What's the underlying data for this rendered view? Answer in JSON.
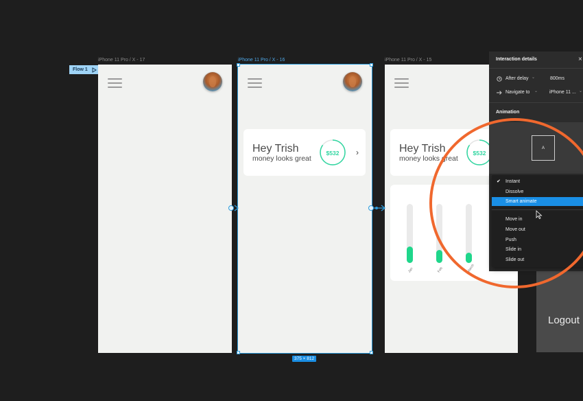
{
  "canvas": {
    "flow_tag": {
      "label": "Flow 1",
      "icon": "play-outline-icon"
    },
    "frames": [
      {
        "label": "iPhone 11 Pro / X - 17"
      },
      {
        "label": "iPhone 11 Pro / X - 16",
        "selected": true,
        "size_label": "375 × 812"
      },
      {
        "label": "iPhone 11 Pro / X - 15"
      }
    ],
    "app": {
      "greeting": "Hey Trish",
      "subtitle": "money looks great",
      "amount": "$532",
      "amount_progress": 0.85,
      "chevron": "›",
      "accent": "#2fd6a0",
      "bar_color": "#1fd68b",
      "bars": [
        {
          "label": "Jan",
          "value": 0.28
        },
        {
          "label": "Feb",
          "value": 0.22
        },
        {
          "label": "March",
          "value": 0.18
        }
      ]
    },
    "logout_label": "Logout",
    "highlight_color": "#f0682e"
  },
  "panel": {
    "title": "Interaction details",
    "close_icon": "×",
    "trigger": {
      "icon": "timer-icon",
      "label": "After delay",
      "value": "800ms"
    },
    "action": {
      "icon": "arrow-right-icon",
      "label": "Navigate to",
      "value": "iPhone 11 ..."
    },
    "animation_title": "Animation",
    "preview_letter": "A",
    "caret": "⌄",
    "menu": {
      "items": [
        {
          "label": "Instant",
          "checked": true
        },
        {
          "label": "Dissolve"
        },
        {
          "label": "Smart animate",
          "highlighted": true
        },
        {
          "label": "Move in"
        },
        {
          "label": "Move out"
        },
        {
          "label": "Push"
        },
        {
          "label": "Slide in"
        },
        {
          "label": "Slide out"
        }
      ],
      "check_glyph": "✔"
    }
  }
}
